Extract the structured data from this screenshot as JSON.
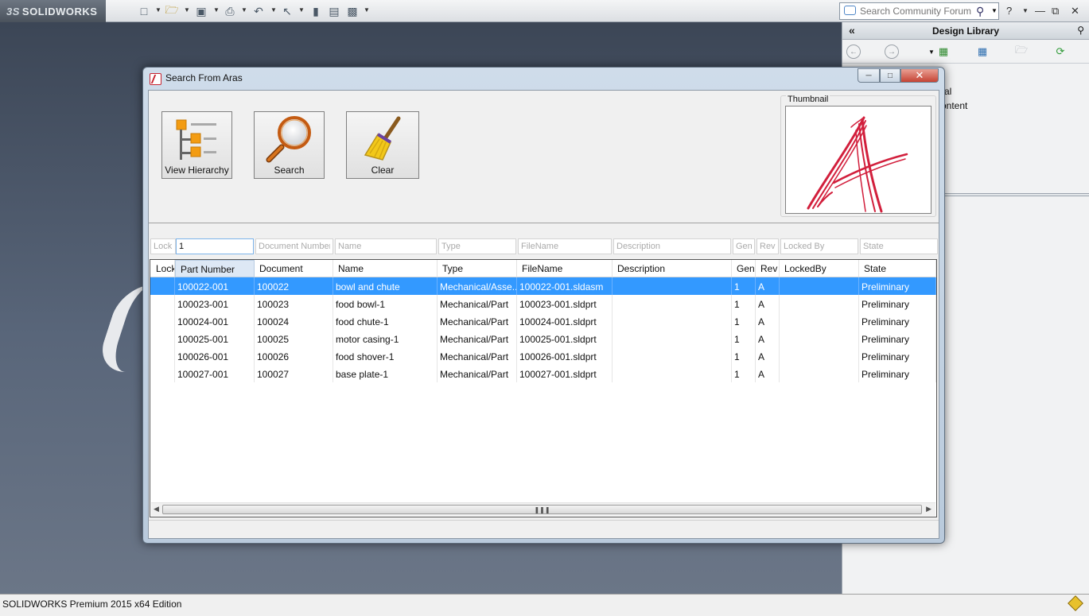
{
  "app": {
    "logo_text": "SOLIDWORKS",
    "logo_prefix": "3S",
    "search_placeholder": "Search Community Forum",
    "status_text": "SOLIDWORKS Premium 2015 x64 Edition"
  },
  "design_library": {
    "title": "Design Library",
    "tree_items": [
      "ral",
      "ontent"
    ]
  },
  "dialog": {
    "title": "Search From Aras",
    "buttons": {
      "view_hierarchy": "View Hierarchy",
      "search": "Search",
      "clear": "Clear"
    },
    "thumbnail_label": "Thumbnail",
    "filters": {
      "lock": "Lock",
      "part_number_value": "1",
      "document_number": "Document Number",
      "name": "Name",
      "type": "Type",
      "filename": "FileName",
      "description": "Description",
      "gen": "Gen",
      "rev": "Rev",
      "locked_by": "Locked By",
      "state": "State"
    },
    "columns": [
      "Lock",
      "Part Number",
      "Document",
      "Name",
      "Type",
      "FileName",
      "Description",
      "Gen",
      "Rev",
      "LockedBy",
      "State"
    ],
    "rows": [
      {
        "lock": "",
        "part_number": "100022-001",
        "document": "100022",
        "name": "bowl and chute",
        "type": "Mechanical/Asse...",
        "filename": "100022-001.sldasm",
        "description": "",
        "gen": "1",
        "rev": "A",
        "locked_by": "",
        "state": "Preliminary"
      },
      {
        "lock": "",
        "part_number": "100023-001",
        "document": "100023",
        "name": "food bowl-1",
        "type": "Mechanical/Part",
        "filename": "100023-001.sldprt",
        "description": "",
        "gen": "1",
        "rev": "A",
        "locked_by": "",
        "state": "Preliminary"
      },
      {
        "lock": "",
        "part_number": "100024-001",
        "document": "100024",
        "name": "food chute-1",
        "type": "Mechanical/Part",
        "filename": "100024-001.sldprt",
        "description": "",
        "gen": "1",
        "rev": "A",
        "locked_by": "",
        "state": "Preliminary"
      },
      {
        "lock": "",
        "part_number": "100025-001",
        "document": "100025",
        "name": "motor casing-1",
        "type": "Mechanical/Part",
        "filename": "100025-001.sldprt",
        "description": "",
        "gen": "1",
        "rev": "A",
        "locked_by": "",
        "state": "Preliminary"
      },
      {
        "lock": "",
        "part_number": "100026-001",
        "document": "100026",
        "name": "food shover-1",
        "type": "Mechanical/Part",
        "filename": "100026-001.sldprt",
        "description": "",
        "gen": "1",
        "rev": "A",
        "locked_by": "",
        "state": "Preliminary"
      },
      {
        "lock": "",
        "part_number": "100027-001",
        "document": "100027",
        "name": "base plate-1",
        "type": "Mechanical/Part",
        "filename": "100027-001.sldprt",
        "description": "",
        "gen": "1",
        "rev": "A",
        "locked_by": "",
        "state": "Preliminary"
      }
    ],
    "selected_row": 0
  },
  "colors": {
    "selection": "#3399ff",
    "aras_red": "#d21f3c"
  }
}
